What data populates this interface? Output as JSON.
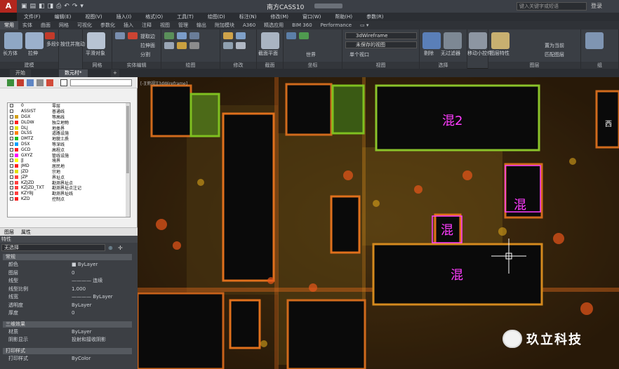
{
  "window": {
    "title": "南方CASS10",
    "search_placeholder": "键入关键字或短语",
    "login": "登录"
  },
  "qat": [
    "▣",
    "▤",
    "◧",
    "◨",
    "⎙",
    "↶",
    "↷",
    "▾"
  ],
  "menu": [
    "文件(F)",
    "编辑(E)",
    "视图(V)",
    "插入(I)",
    "格式(O)",
    "工具(T)",
    "绘图(D)",
    "标注(N)",
    "修改(M)",
    "窗口(W)",
    "帮助(H)",
    "参数(R)"
  ],
  "ribbon_tabs": [
    "常用",
    "实体",
    "曲面",
    "网格",
    "可视化",
    "参数化",
    "插入",
    "注释",
    "视图",
    "管理",
    "输出",
    "附加模块",
    "A360",
    "精选应用",
    "BIM 360",
    "Performance",
    "▭ ▾"
  ],
  "ribbon": {
    "groups": [
      "建模",
      "网格",
      "实体编辑",
      "绘图",
      "修改",
      "截面",
      "坐标",
      "视图",
      "选择",
      "",
      "图层",
      "组"
    ],
    "labels": {
      "box": "长方体",
      "extrude": "拉伸",
      "smooth": "平滑对象",
      "section_plane": "截面平面",
      "culling": "剔除",
      "filter": "无过滤器",
      "gizmo": "移动小控件",
      "layer_props": "图层特性"
    },
    "small_labels": [
      "多段体",
      "按住并拖动",
      "提取边",
      "拉伸面",
      "分割",
      "世界",
      "单个视口",
      "置为当前",
      "匹配图层"
    ],
    "visual_style": "3dWireframe",
    "view_combo": "未保存的视图"
  },
  "doc_tabs": {
    "start": "开始",
    "active": "数元村*",
    "add": "+"
  },
  "layer_panel": {
    "layers": [
      {
        "name": "0",
        "desc": "零层",
        "color": "#ffffff"
      },
      {
        "name": "ASSIST",
        "desc": "普通线",
        "color": "#ffffff"
      },
      {
        "name": "DGX",
        "desc": "等高线",
        "color": "#d4a017"
      },
      {
        "name": "DLDW",
        "desc": "独立地物",
        "color": "#ff2020"
      },
      {
        "name": "DLJ",
        "desc": "地类界",
        "color": "#e0e000"
      },
      {
        "name": "DLSS",
        "desc": "道路设施",
        "color": "#ff8000"
      },
      {
        "name": "DMTZ",
        "desc": "地貌土质",
        "color": "#20c020"
      },
      {
        "name": "DSX",
        "desc": "等深线",
        "color": "#00a0ff"
      },
      {
        "name": "GCD",
        "desc": "高程点",
        "color": "#ff2020"
      },
      {
        "name": "GXYZ",
        "desc": "管线设施",
        "color": "#ff00ff"
      },
      {
        "name": "JJ",
        "desc": "境界",
        "color": "#ffff00"
      },
      {
        "name": "JMD",
        "desc": "居民地",
        "color": "#ff2020"
      },
      {
        "name": "JZD",
        "desc": "宗地",
        "color": "#e0e000"
      },
      {
        "name": "JZP",
        "desc": "界址点",
        "color": "#ff4040"
      },
      {
        "name": "KZJZD",
        "desc": "勘测界址点",
        "color": "#ff4040"
      },
      {
        "name": "KZJZD_TXT",
        "desc": "勘测界址点注记",
        "color": "#ff4040"
      },
      {
        "name": "KZYBJ",
        "desc": "勘测界址线",
        "color": "#ff4040"
      },
      {
        "name": "KZD",
        "desc": "控制点",
        "color": "#ff2020"
      }
    ],
    "tab_layers": "图层",
    "tab_props": "属性"
  },
  "properties": {
    "header": "特性",
    "selection": "无选择",
    "sections": [
      {
        "title": "常规",
        "rows": [
          {
            "k": "颜色",
            "v": "■ ByLayer"
          },
          {
            "k": "图层",
            "v": "0"
          },
          {
            "k": "线型",
            "v": "———— 连续"
          },
          {
            "k": "线型比例",
            "v": "1.000"
          },
          {
            "k": "线宽",
            "v": "———— ByLayer"
          },
          {
            "k": "透明度",
            "v": "ByLayer"
          },
          {
            "k": "厚度",
            "v": "0"
          }
        ]
      },
      {
        "title": "三维效果",
        "rows": [
          {
            "k": "材质",
            "v": "ByLayer"
          },
          {
            "k": "阴影显示",
            "v": "投射和接收阴影"
          }
        ]
      },
      {
        "title": "打印样式",
        "rows": [
          {
            "k": "打印样式",
            "v": "ByColor"
          }
        ]
      }
    ]
  },
  "viewport": {
    "label": "[-][俯视][3dWireframe]",
    "annotations": [
      "混2",
      "混",
      "混",
      "混",
      "西"
    ]
  },
  "watermark": "玖立科技",
  "colors": {
    "accent": "#b3261e",
    "annotation": "#ff3cff",
    "cloud_hot": "#e8561a",
    "cloud_warm": "#d9a21b",
    "cloud_green": "#7fc020"
  }
}
